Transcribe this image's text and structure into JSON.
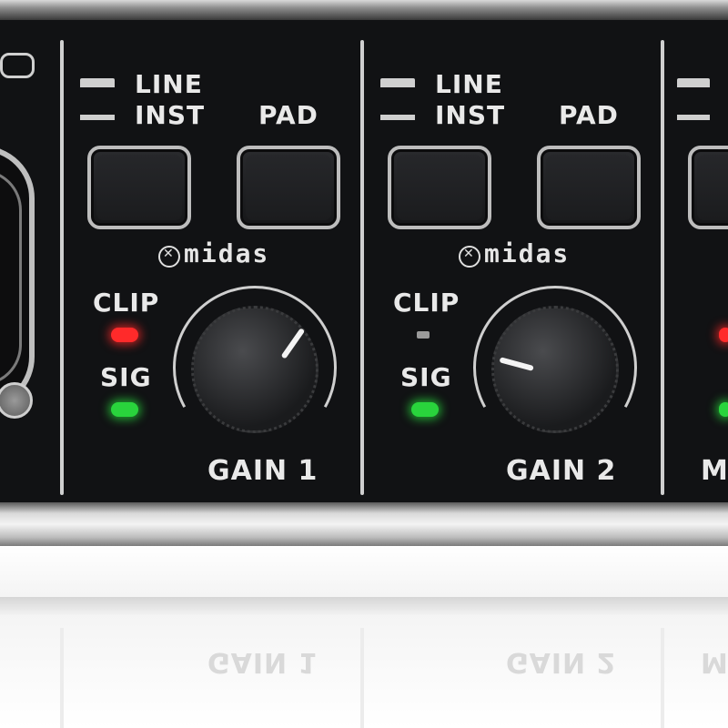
{
  "channels": [
    {
      "switch_top": "LINE",
      "switch_bottom": "INST",
      "pad": "PAD",
      "brand": "midas",
      "clip": "CLIP",
      "sig": "SIG",
      "gain": "GAIN 1",
      "clip_state": "on",
      "sig_state": "on"
    },
    {
      "switch_top": "LINE",
      "switch_bottom": "INST",
      "pad": "PAD",
      "brand": "midas",
      "clip": "CLIP",
      "sig": "SIG",
      "gain": "GAIN 2",
      "clip_state": "off",
      "sig_state": "on"
    }
  ],
  "partial_right": {
    "bottom_label": "M"
  },
  "reflection": {
    "label_1": "GAIN 1",
    "label_2": "GAIN 2",
    "label_3": "M"
  },
  "colors": {
    "led_red": "#ff2a2a",
    "led_green": "#29d43c",
    "panel": "#151618"
  }
}
